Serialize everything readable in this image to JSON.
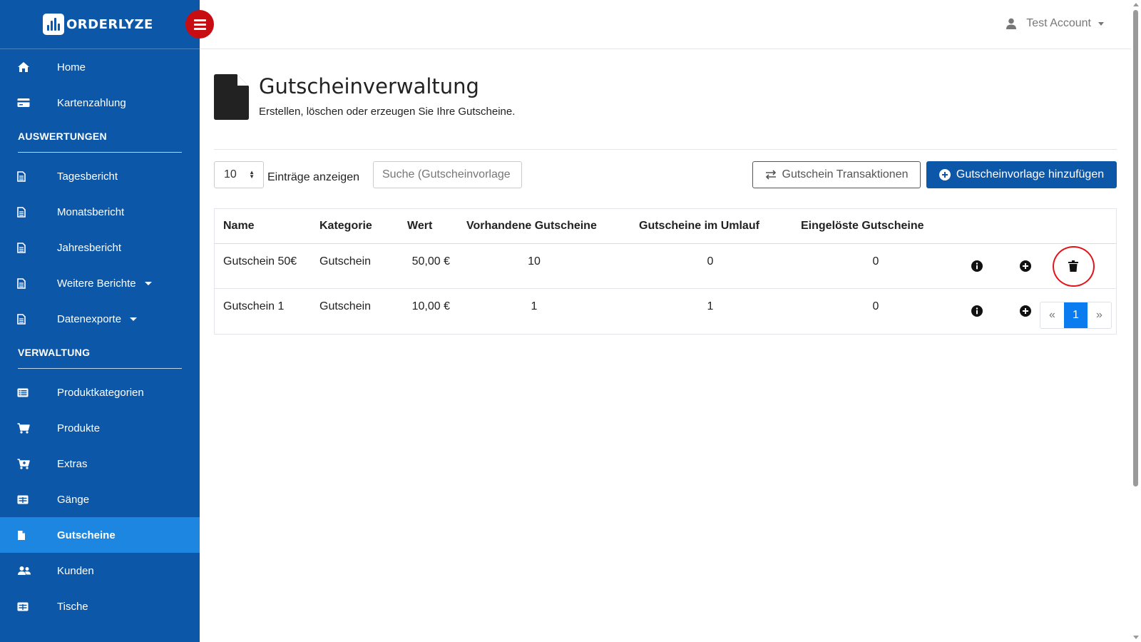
{
  "brand": {
    "name": "ORDERLYZE"
  },
  "sidebar": {
    "top_items": [
      {
        "label": "Home",
        "icon": "home-icon"
      },
      {
        "label": "Kartenzahlung",
        "icon": "credit-card-icon"
      }
    ],
    "sections": [
      {
        "title": "AUSWERTUNGEN",
        "items": [
          {
            "label": "Tagesbericht",
            "icon": "document-icon"
          },
          {
            "label": "Monatsbericht",
            "icon": "document-icon"
          },
          {
            "label": "Jahresbericht",
            "icon": "document-icon"
          },
          {
            "label": "Weitere Berichte",
            "icon": "document-icon",
            "has_dropdown": true
          },
          {
            "label": "Datenexporte",
            "icon": "document-icon",
            "has_dropdown": true
          }
        ]
      },
      {
        "title": "VERWALTUNG",
        "items": [
          {
            "label": "Produktkategorien",
            "icon": "list-icon"
          },
          {
            "label": "Produkte",
            "icon": "cart-icon"
          },
          {
            "label": "Extras",
            "icon": "cart-plus-icon"
          },
          {
            "label": "Gänge",
            "icon": "table-icon"
          },
          {
            "label": "Gutscheine",
            "icon": "file-icon",
            "active": true
          },
          {
            "label": "Kunden",
            "icon": "users-icon"
          },
          {
            "label": "Tische",
            "icon": "table-icon"
          }
        ]
      }
    ]
  },
  "topbar": {
    "account_name": "Test Account"
  },
  "page": {
    "title": "Gutscheinverwaltung",
    "subtitle": "Erstellen, löschen oder erzeugen Sie Ihre Gutscheine."
  },
  "controls": {
    "entries_value": "10",
    "entries_label": "Einträge anzeigen",
    "search_placeholder": "Suche (Gutscheinvorlage",
    "transactions_button": "Gutschein Transaktionen",
    "add_button": "Gutscheinvorlage hinzufügen"
  },
  "table": {
    "headers": {
      "name": "Name",
      "category": "Kategorie",
      "value": "Wert",
      "available": "Vorhandene Gutscheine",
      "circulating": "Gutscheine im Umlauf",
      "redeemed": "Eingelöste Gutscheine"
    },
    "rows": [
      {
        "name": "Gutschein 50€",
        "category": "Gutschein",
        "value": "50,00 €",
        "available": "10",
        "circulating": "0",
        "redeemed": "0"
      },
      {
        "name": "Gutschein 1",
        "category": "Gutschein",
        "value": "10,00 €",
        "available": "1",
        "circulating": "1",
        "redeemed": "0"
      }
    ]
  },
  "pagination": {
    "prev": "«",
    "current": "1",
    "next": "»"
  },
  "colors": {
    "sidebar": "#0d57a9",
    "active_item": "#1d86e0",
    "toggle": "#c80d12",
    "primary": "#0d57a9",
    "highlight": "#e0141b"
  }
}
